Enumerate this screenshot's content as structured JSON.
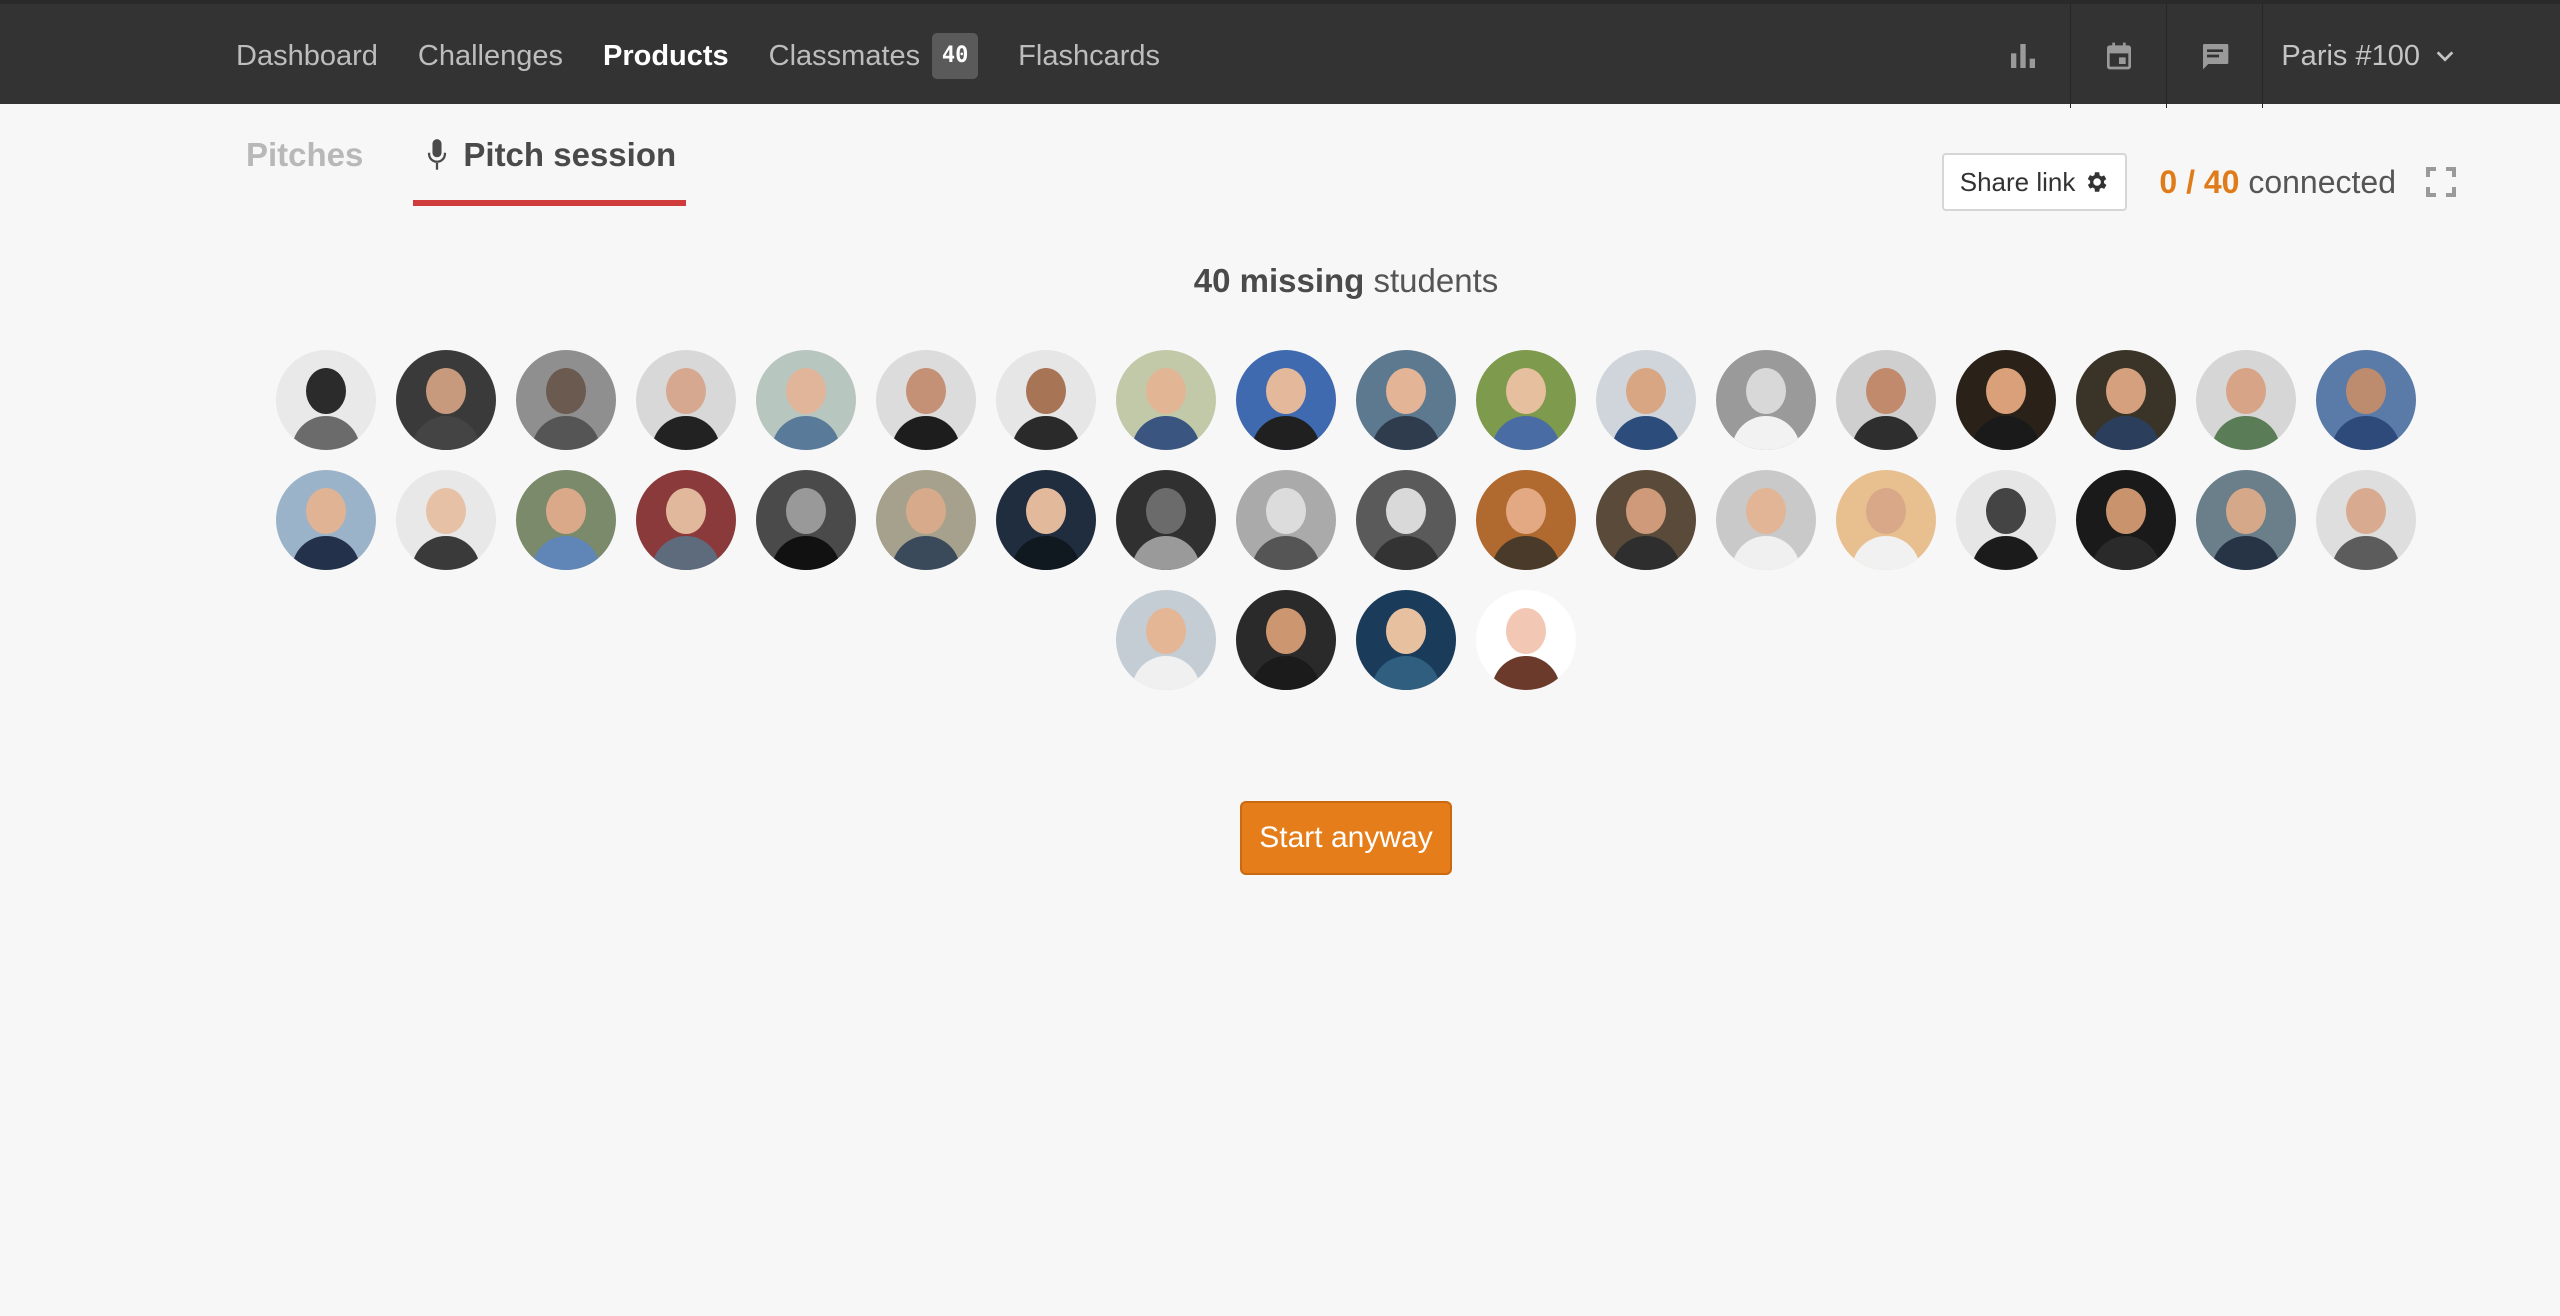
{
  "navbar": {
    "links": [
      {
        "label": "Dashboard"
      },
      {
        "label": "Challenges"
      },
      {
        "label": "Products"
      },
      {
        "label": "Classmates",
        "badge": "40"
      },
      {
        "label": "Flashcards"
      }
    ],
    "active_link": "Products",
    "icons": [
      "bar-chart-icon",
      "calendar-icon",
      "chat-icon"
    ],
    "user_label": "Paris #100"
  },
  "tabs": [
    {
      "label": "Pitches",
      "active": false
    },
    {
      "label": "Pitch session",
      "active": true,
      "icon": "microphone-icon"
    }
  ],
  "tools": {
    "share_label": "Share link",
    "share_icon": "gear-icon",
    "connected_count": "0 / 40",
    "connected_label": "connected",
    "fullscreen_icon": "fullscreen-icon"
  },
  "missing": {
    "count_label": "40 missing",
    "suffix": "students"
  },
  "avatars": {
    "colors": [
      [
        "#e9e9e9",
        "#2b2b2b",
        "#6b6b6b"
      ],
      [
        "#3a3a3a",
        "#c89a7d",
        "#444"
      ],
      [
        "#8f8f8f",
        "#6a5a50",
        "#555"
      ],
      [
        "#d8d8d8",
        "#d6a890",
        "#222"
      ],
      [
        "#b8c6c0",
        "#e0b59a",
        "#5a7a9a"
      ],
      [
        "#dcdcdc",
        "#c49076",
        "#1d1d1d"
      ],
      [
        "#e6e6e6",
        "#a77456",
        "#2a2a2a"
      ],
      [
        "#c2c9a8",
        "#e2b595",
        "#3a5580"
      ],
      [
        "#3f6ab0",
        "#e4b89b",
        "#202020"
      ],
      [
        "#5d7990",
        "#e3b495",
        "#2f3c4d"
      ],
      [
        "#7e9a4c",
        "#e6bf9e",
        "#4a6ca4"
      ],
      [
        "#d0d5db",
        "#d9a684",
        "#2c4c7c"
      ],
      [
        "#9a9a9a",
        "#d8d8d8",
        "#f2f2f2"
      ],
      [
        "#cfcfcf",
        "#c18a6c",
        "#2e2e2e"
      ],
      [
        "#2a2218",
        "#d9a07a",
        "#1a1a1a"
      ],
      [
        "#3a3328",
        "#d4a07e",
        "#2b3f5c"
      ],
      [
        "#d6d6d6",
        "#d7a488",
        "#5a7c56"
      ],
      [
        "#5a7aa8",
        "#bd8c6e",
        "#2d4a7a"
      ],
      [
        "#9bb3c8",
        "#e0b394",
        "#23324a"
      ],
      [
        "#e8e8e8",
        "#e6c1a5",
        "#3a3a3a"
      ],
      [
        "#7a8a6a",
        "#d9a98a",
        "#5f86b6"
      ],
      [
        "#8a3a3a",
        "#e1b89c",
        "#5d6b7d"
      ],
      [
        "#4a4a4a",
        "#999",
        "#111"
      ],
      [
        "#a6a18d",
        "#d7aa8b",
        "#3a4a5a"
      ],
      [
        "#1f2d3e",
        "#e3b99c",
        "#101820"
      ],
      [
        "#303030",
        "#6b6b6b",
        "#9a9a9a"
      ],
      [
        "#aaaaaa",
        "#dcdcdc",
        "#555"
      ],
      [
        "#5a5a5a",
        "#d9d9d9",
        "#333"
      ],
      [
        "#b06a30",
        "#e2a983",
        "#4a3a2a"
      ],
      [
        "#5a4a3a",
        "#cf9a7a",
        "#2e2e2e"
      ],
      [
        "#c9c9c9",
        "#e1b596",
        "#f0f0f0"
      ],
      [
        "#e8c090",
        "#d9a888",
        "#f1f1f1"
      ],
      [
        "#e6e6e6",
        "#444",
        "#1b1b1b"
      ],
      [
        "#1a1a1a",
        "#c9936e",
        "#2a2a2a"
      ],
      [
        "#6a7f8a",
        "#d6a88a",
        "#273445"
      ],
      [
        "#dedede",
        "#d8ab90",
        "#5c5c5c"
      ],
      [
        "#c4ccd4",
        "#e4b696",
        "#f0f0f0"
      ],
      [
        "#2a2a2a",
        "#cc9670",
        "#1b1b1b"
      ],
      [
        "#1a3c5a",
        "#e7c09f",
        "#2f5e7e"
      ],
      [
        "#ffffff",
        "#f2c8b4",
        "#6b3a2a"
      ]
    ]
  },
  "start_button": {
    "label": "Start anyway"
  }
}
